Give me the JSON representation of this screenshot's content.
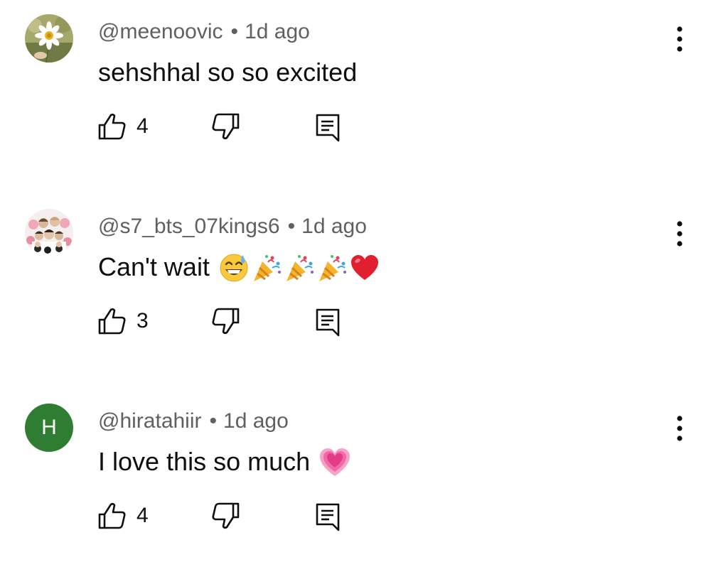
{
  "comments": [
    {
      "avatar_icon": "daisy-flower-avatar",
      "username": "@meenoovic",
      "separator": "•",
      "time": "1d ago",
      "text": "sehshhal so so excited",
      "emojis": [],
      "likes": "4"
    },
    {
      "avatar_icon": "group-photo-avatar",
      "username": "@s7_bts_07kings6",
      "separator": "•",
      "time": "1d ago",
      "text": "Can't wait",
      "emojis": [
        "grinning-sweat-emoji",
        "party-popper-emoji",
        "party-popper-emoji",
        "party-popper-emoji",
        "red-heart-emoji"
      ],
      "likes": "3"
    },
    {
      "avatar_icon": "letter-avatar",
      "avatar_letter": "H",
      "avatar_color": "#2e7d32",
      "username": "@hiratahiir",
      "separator": "•",
      "time": "1d ago",
      "text": "I love this so much",
      "emojis": [
        "growing-heart-emoji"
      ],
      "likes": "4"
    }
  ],
  "icons": {
    "like": "thumbs-up-outline-icon",
    "dislike": "thumbs-down-outline-icon",
    "reply": "reply-comment-icon",
    "more": "vertical-dots-menu-icon"
  }
}
